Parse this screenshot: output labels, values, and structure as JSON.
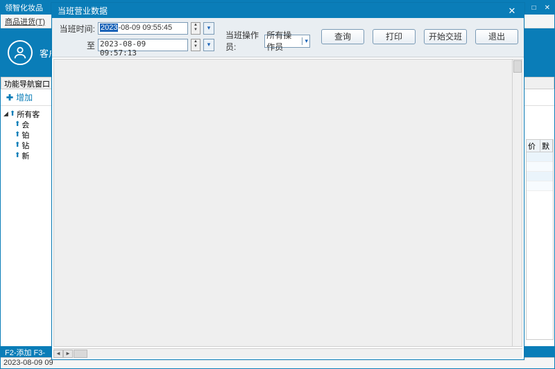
{
  "main": {
    "title": "领智化妆品",
    "menu_goods": "商品进货(T)",
    "win_min": "—",
    "win_max": "□",
    "win_close": "✕"
  },
  "toolbar": {
    "customer_mgmt": "客户管理"
  },
  "nav": {
    "header": "功能导航窗口",
    "add": "增加"
  },
  "tree": {
    "root": "所有客",
    "n1": "会",
    "n2": "铂",
    "n3": "钻",
    "n4": "新"
  },
  "grid": {
    "col1": "价",
    "col2": "默"
  },
  "status": {
    "blue": "F2-添加 F3-",
    "date": "2023-08-09 09"
  },
  "dialog": {
    "title": "当班营业数据",
    "time_label": "当班时间:",
    "to_label": "至",
    "start_year": "2023",
    "start_rest": "-08-09  09:55:45",
    "end": "2023-08-09  09:57:13",
    "operator_label": "当班操作员:",
    "operator_value": "所有操作员",
    "btn_query": "查询",
    "btn_print": "打印",
    "btn_start": "开始交班",
    "btn_exit": "退出"
  }
}
